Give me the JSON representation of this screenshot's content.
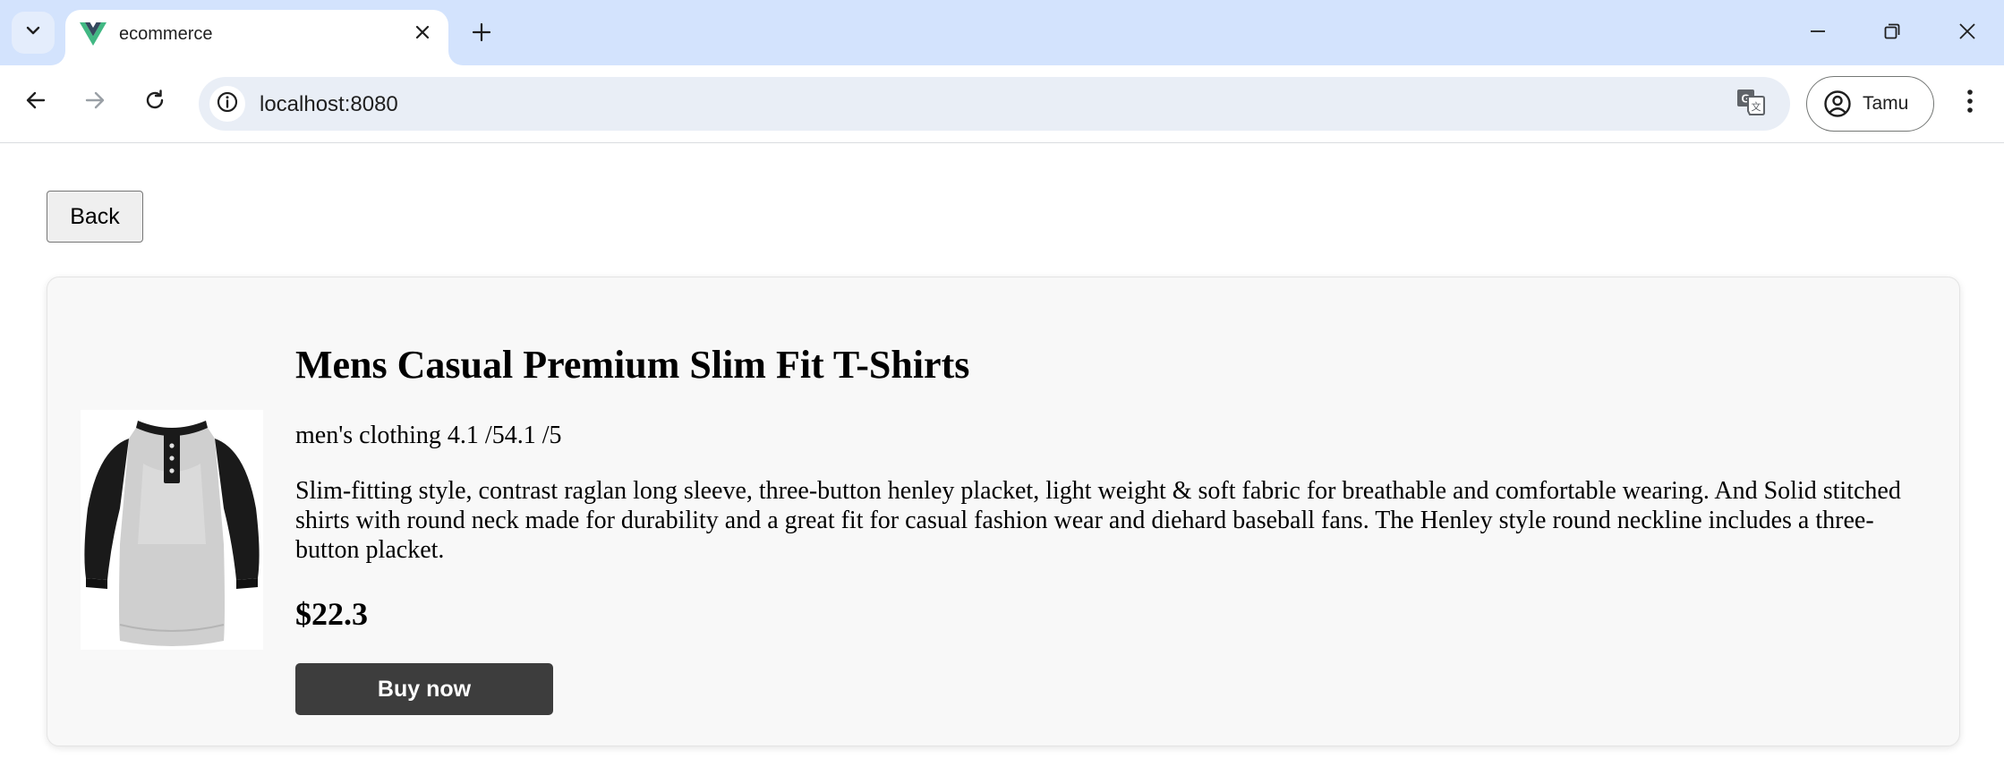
{
  "browser": {
    "tab": {
      "title": "ecommerce",
      "favicon": "vue-logo-icon"
    },
    "url": "localhost:8080",
    "profile": {
      "name": "Tamu"
    },
    "colors": {
      "tabstrip": "#d3e3fd",
      "omnibox": "#e9eef6",
      "vue_green": "#41b883",
      "vue_dark": "#35495e"
    }
  },
  "page": {
    "back_label": "Back",
    "product": {
      "title": "Mens Casual Premium Slim Fit T-Shirts",
      "meta": "men's clothing 4.1 /54.1 /5",
      "description": "Slim-fitting style, contrast raglan long sleeve, three-button henley placket, light weight & soft fabric for breathable and comfortable wearing. And Solid stitched shirts with round neck made for durability and a great fit for casual fashion wear and diehard baseball fans. The Henley style round neckline includes a three-button placket.",
      "price": "$22.3",
      "buy_label": "Buy now"
    },
    "colors": {
      "card_bg": "#f8f8f8",
      "buy_button": "#3d3d3d"
    }
  }
}
